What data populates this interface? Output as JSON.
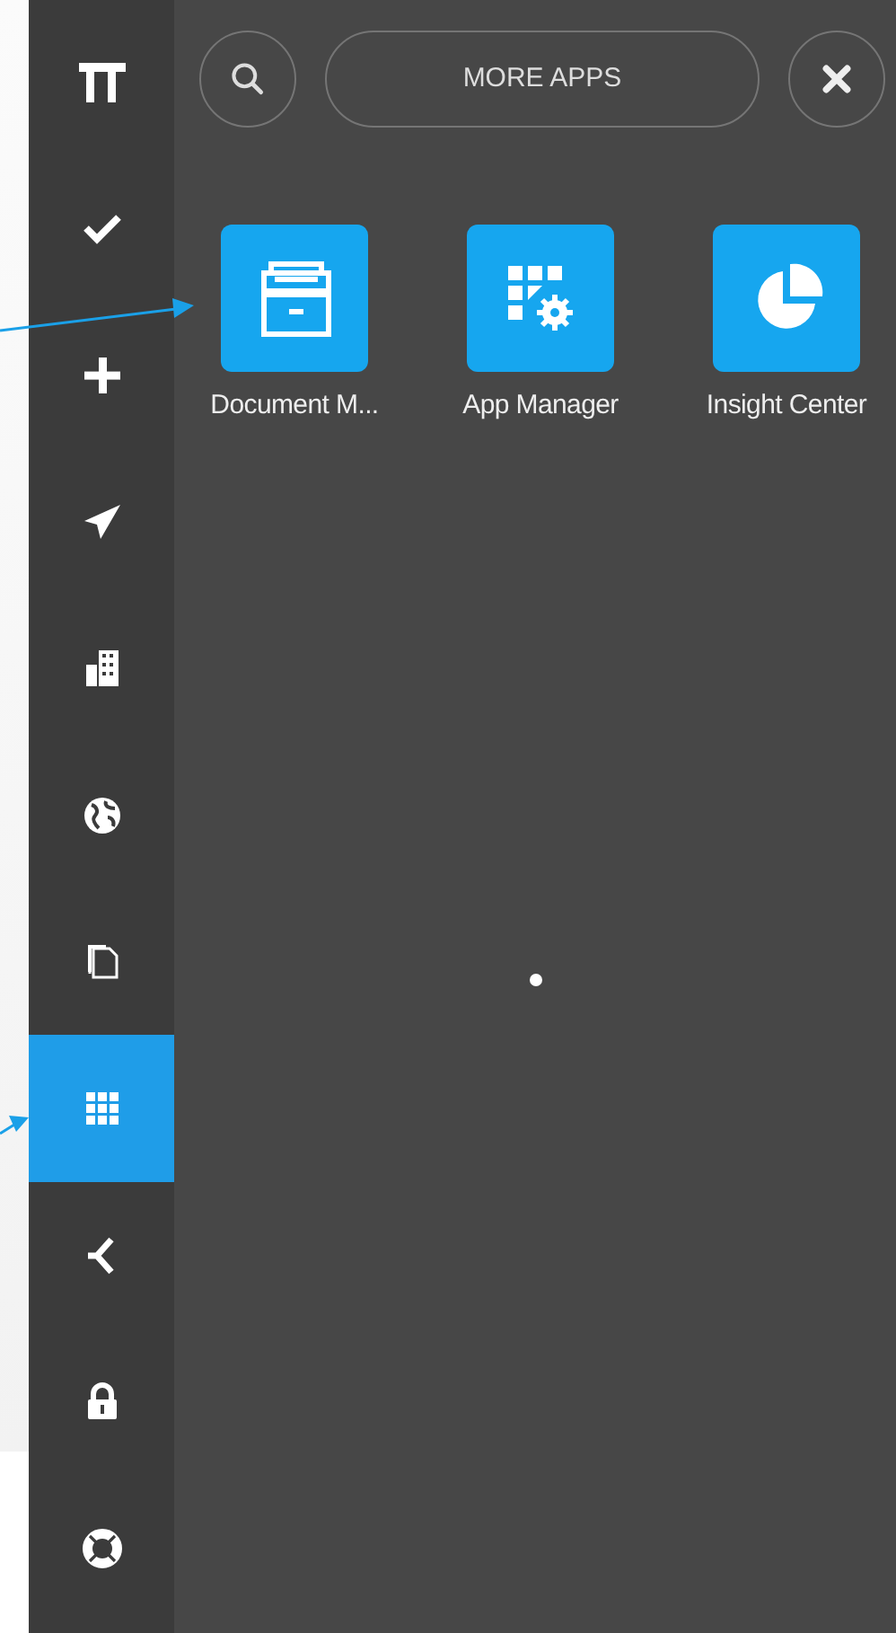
{
  "sidebar": {
    "items": [
      {
        "selected": false
      },
      {
        "selected": false
      },
      {
        "selected": false
      },
      {
        "selected": false
      },
      {
        "selected": false
      },
      {
        "selected": false
      },
      {
        "selected": true
      },
      {
        "selected": false
      },
      {
        "selected": false
      },
      {
        "selected": false
      }
    ]
  },
  "header": {
    "title_button": "MORE APPS"
  },
  "apps": [
    {
      "label": "Document M..."
    },
    {
      "label": "App Manager"
    },
    {
      "label": "Insight Center"
    }
  ],
  "pager": [
    {
      "selected": true
    }
  ]
}
